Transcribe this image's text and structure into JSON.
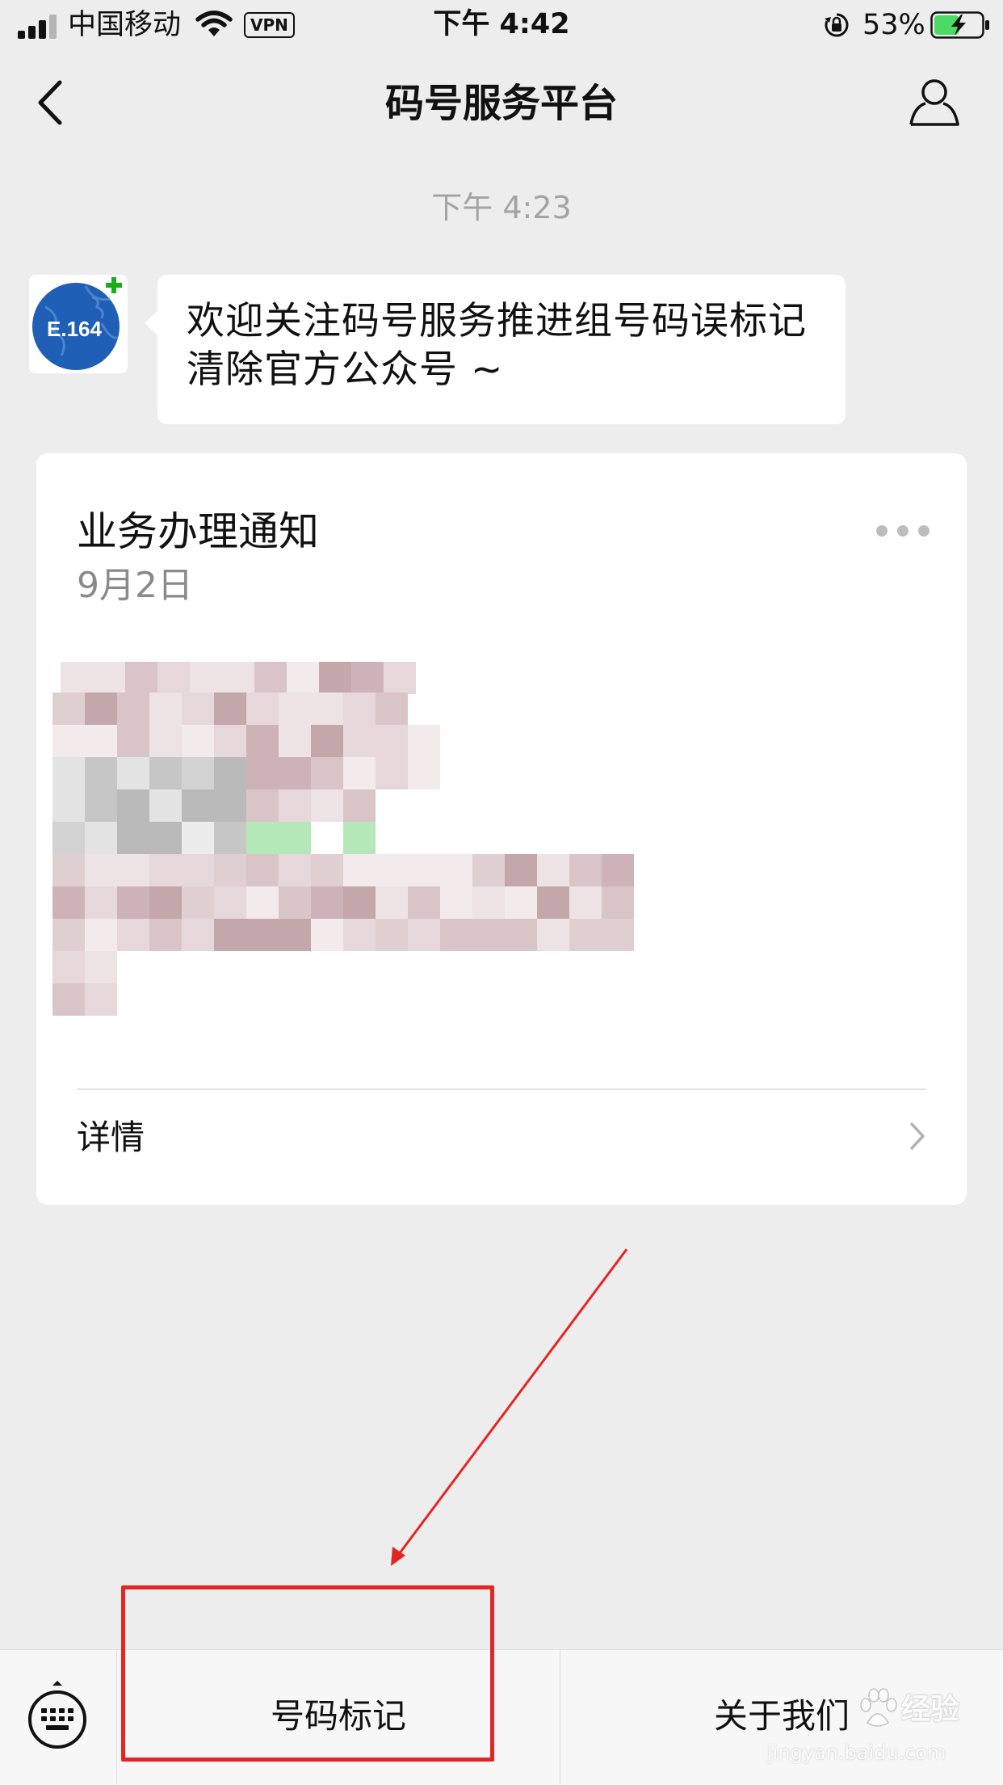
{
  "status_bar": {
    "carrier": "中国移动",
    "vpn": "VPN",
    "time": "下午 4:42",
    "battery_percent": "53%",
    "battery_level": 0.53,
    "signal_bars": 3
  },
  "nav": {
    "title": "码号服务平台",
    "back_icon": "chevron-left-icon",
    "profile_icon": "person-icon"
  },
  "chat": {
    "timestamp": "下午 4:23",
    "avatar_text": "E.164",
    "welcome_message": "欢迎关注码号服务推进组号码误标记清除官方公众号 ~",
    "card": {
      "title": "业务办理通知",
      "date": "9月2日",
      "detail_label": "详情"
    }
  },
  "bottom_menu": {
    "keyboard_icon": "keyboard-icon",
    "items": [
      {
        "label": "号码标记"
      },
      {
        "label": "关于我们"
      }
    ]
  },
  "watermark": {
    "brand": "经验",
    "url": "jingyan.baidu.com"
  },
  "colors": {
    "background": "#ededed",
    "annotation_red": "#e52424",
    "battery_green": "#4cd964",
    "avatar_blue": "#1f5fb5"
  }
}
